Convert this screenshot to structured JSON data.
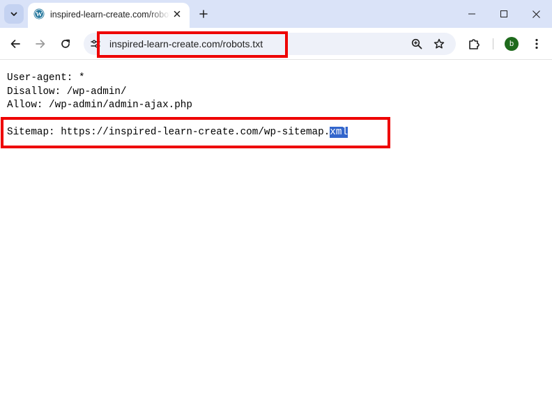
{
  "tab": {
    "title": "inspired-learn-create.com/robots.txt",
    "favicon": "wordpress-icon"
  },
  "toolbar": {
    "url": "inspired-learn-create.com/robots.txt",
    "avatar_letter": "b",
    "avatar_color": "#1e6a1c"
  },
  "robots": {
    "line1": "User-agent: *",
    "line2": "Disallow: /wp-admin/",
    "line3": "Allow: /wp-admin/admin-ajax.php",
    "sitemap_prefix": "Sitemap: https://inspired-learn-create.com/wp-sitemap.",
    "sitemap_selected": "xml"
  },
  "colors": {
    "tabstrip_bg": "#dae3f8",
    "omnibox_bg": "#eef1f9",
    "highlight_red": "#ee0000",
    "selection_bg": "#3366cc"
  }
}
